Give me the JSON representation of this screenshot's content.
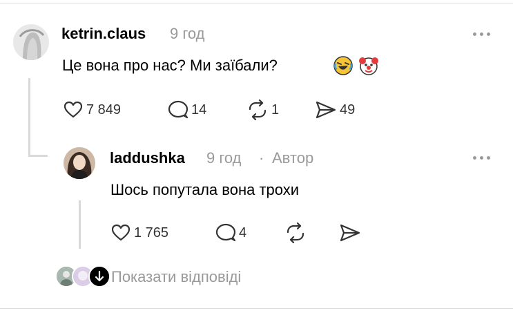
{
  "comment": {
    "username": "ketrin.claus",
    "time": "9 год",
    "text": "Це вона про нас? Ми заїбали?",
    "emojis": [
      "rolling-laughing-emoji",
      "clown-face-emoji"
    ],
    "likes": "7 849",
    "replies": "14",
    "reposts": "1",
    "shares": "49"
  },
  "reply": {
    "username": "laddushka",
    "time": "9 год",
    "separator": "·",
    "author_badge": "Автор",
    "text": "Шось попутала вона трохи",
    "likes": "1 765",
    "replies": "4"
  },
  "footer": {
    "show_replies": "Показати відповіді"
  },
  "icons": {
    "like": "heart-icon",
    "reply": "speech-bubble-icon",
    "repost": "repost-icon",
    "share": "send-icon",
    "more": "more-dots-icon"
  },
  "colors": {
    "text": "#000000",
    "muted": "#999999",
    "icon": "#333333",
    "thread_line": "#d9d9d9",
    "divider": "#dcdcdc"
  }
}
